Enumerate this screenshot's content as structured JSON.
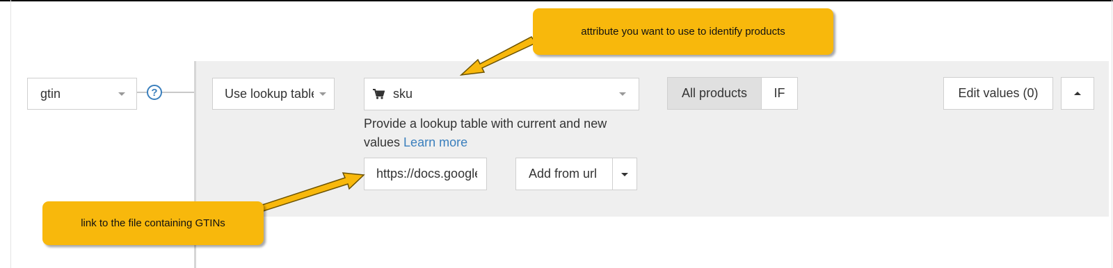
{
  "rule": {
    "attribute": "gtin",
    "help_symbol": "?",
    "mode": "Use lookup table",
    "lookup_attribute": "sku",
    "help_text": "Provide a lookup table with current and new values",
    "learn_more": "Learn more",
    "url_value": "https://docs.google.com",
    "add_from_url": "Add from url",
    "scope_all": "All products",
    "scope_if": "IF",
    "edit_values": "Edit values (0)"
  },
  "annotations": {
    "top": "attribute you want to use to identify products",
    "bottom": "link to the file containing GTINs"
  },
  "icons": {
    "help": "question-circle-icon",
    "lookup": "shopping-cart-icon",
    "collapse": "caret-up-icon"
  },
  "colors": {
    "callout": "#f8b80c",
    "link": "#3a7fbd",
    "panel": "#efefef"
  }
}
